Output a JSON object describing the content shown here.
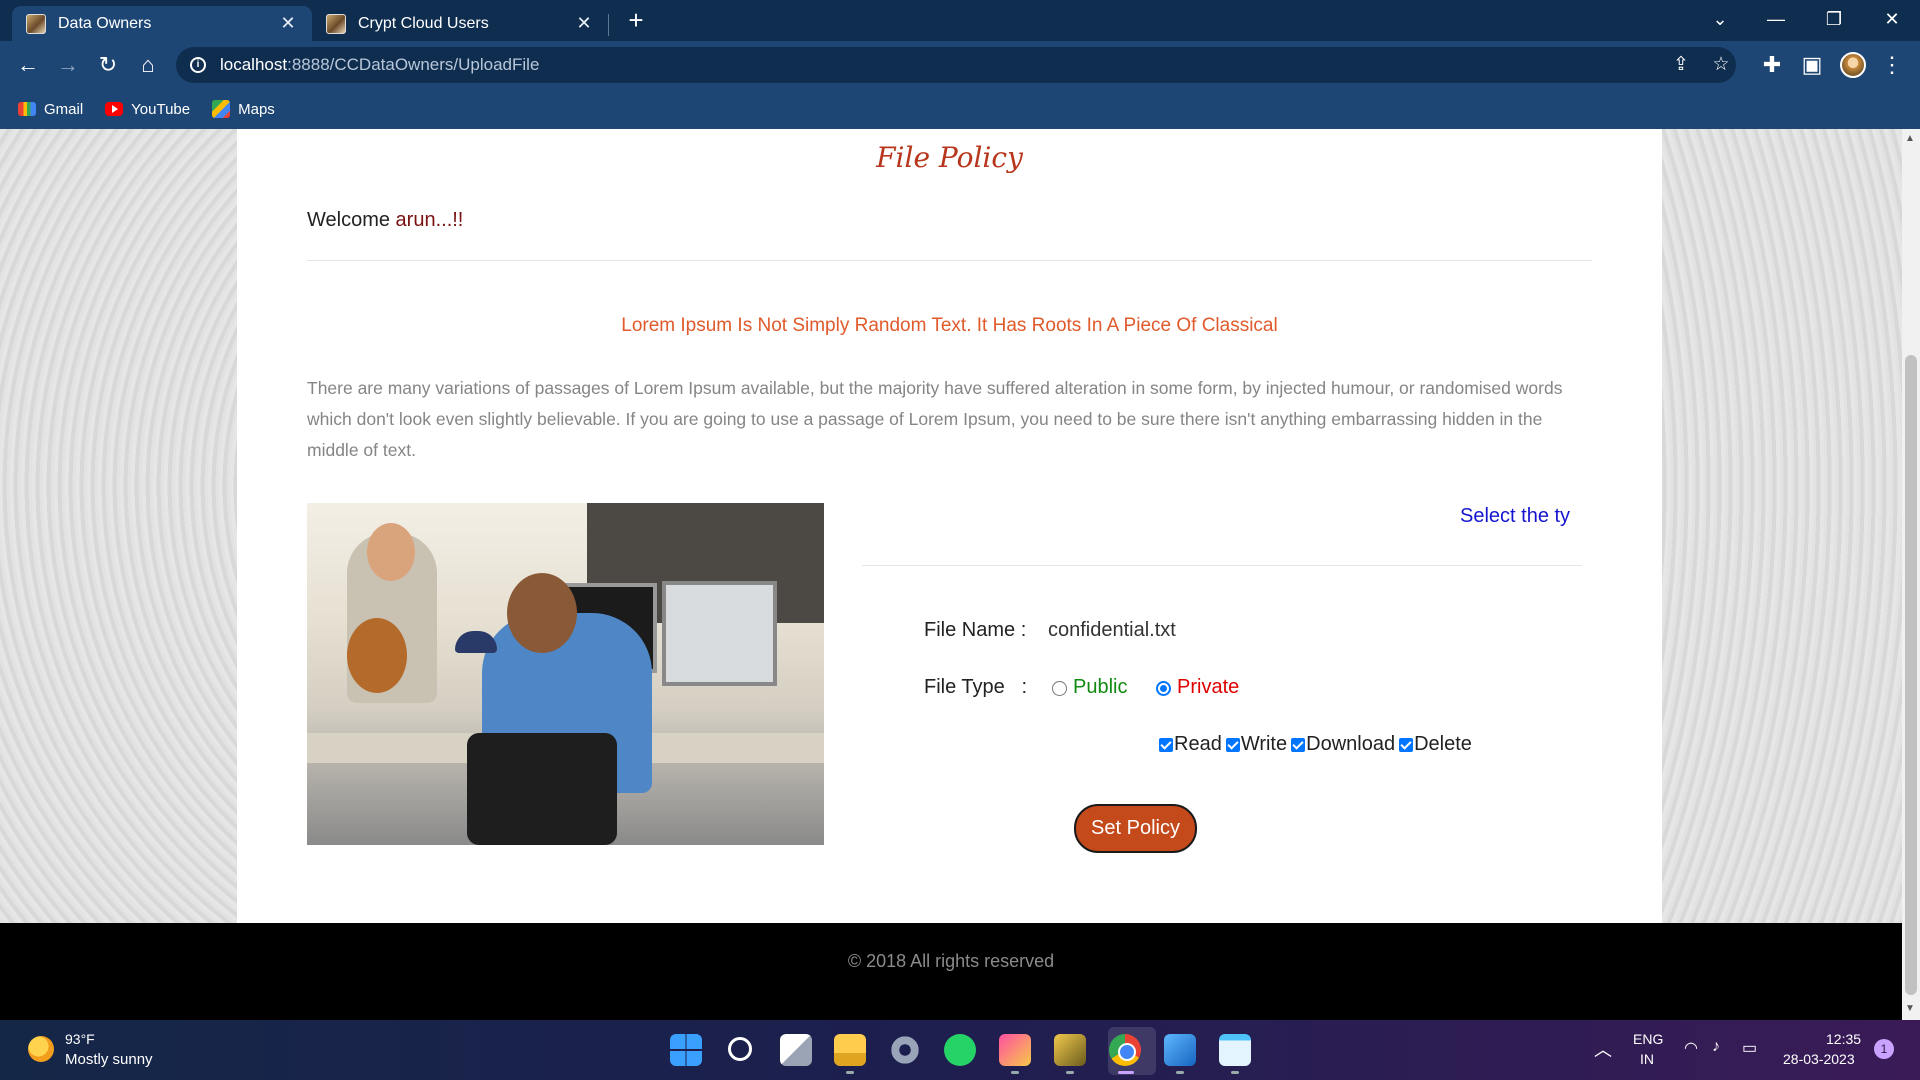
{
  "browser": {
    "tabs": [
      {
        "label": "Data Owners",
        "active": true
      },
      {
        "label": "Crypt Cloud Users",
        "active": false
      }
    ],
    "url_host": "localhost",
    "url_path": ":8888/CCDataOwners/UploadFile",
    "bookmarks": [
      "Gmail",
      "YouTube",
      "Maps"
    ]
  },
  "page": {
    "title": "File Policy",
    "welcome_prefix": "Welcome ",
    "user_name": "arun...!!",
    "subheading": "Lorem Ipsum Is Not Simply Random Text. It Has Roots In A Piece Of Classical",
    "paragraph": "There are many variations of passages of Lorem Ipsum available, but the majority have suffered alteration in some form, by injected humour, or randomised words which don't look even slightly believable. If you are going to use a passage of Lorem Ipsum, you need to be sure there isn't anything embarrassing hidden in the middle of text.",
    "select_title": "Select the ty",
    "form": {
      "file_name_label": "File Name :",
      "file_name_value": "confidential.txt",
      "file_type_label": "File Type   :",
      "file_type_options": [
        "Public",
        "Private"
      ],
      "file_type_selected": "Private",
      "permissions": [
        "Read",
        "Write",
        "Download",
        "Delete"
      ],
      "permissions_checked": [
        true,
        true,
        true,
        true
      ],
      "submit_label": "Set Policy"
    },
    "footer": "© 2018 All rights reserved"
  },
  "taskbar": {
    "weather_temp": "93°F",
    "weather_desc": "Mostly sunny",
    "lang_top": "ENG",
    "lang_bottom": "IN",
    "time": "12:35",
    "date": "28-03-2023",
    "notification_count": "1"
  },
  "colors": {
    "title": "#b8361c",
    "subheading": "#e05a2b",
    "select_title": "#1515d0",
    "public_option": "#108a10",
    "private_option": "#e00000",
    "button": "#c44a1c",
    "chrome_bg": "#1e4674"
  }
}
